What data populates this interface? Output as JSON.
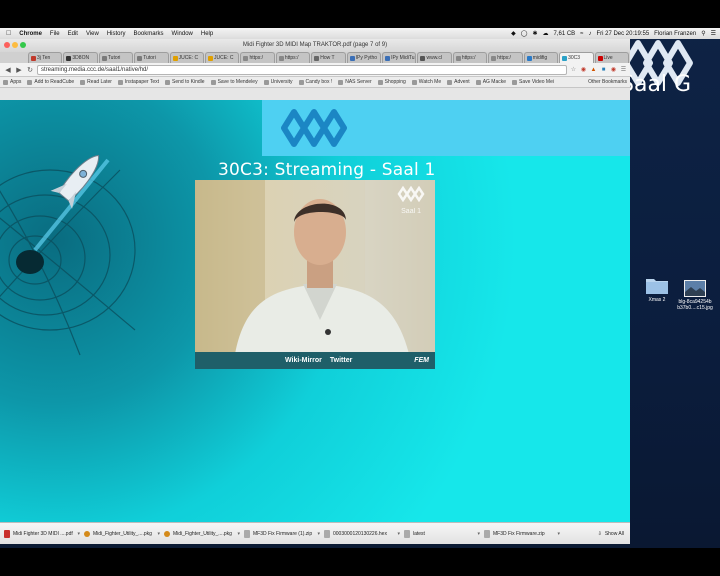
{
  "menubar": {
    "app": "Chrome",
    "items": [
      "File",
      "Edit",
      "View",
      "History",
      "Bookmarks",
      "Window",
      "Help"
    ],
    "battery": "7,61 CB",
    "clock": "Fri 27 Dec 20:19:55",
    "user": "Florian Franzen"
  },
  "window": {
    "title": "Midi Fighter 3D MIDI Map TRAKTOR.pdf (page 7 of 9)",
    "tabs": [
      {
        "label": "3j Ten",
        "color": "#c0392b"
      },
      {
        "label": "3D8ON",
        "color": "#333333"
      },
      {
        "label": "Tutori",
        "color": "#7a7a7a"
      },
      {
        "label": "Tutori",
        "color": "#7a7a7a"
      },
      {
        "label": "JUCE: C",
        "color": "#e0a000"
      },
      {
        "label": "JUCE: C",
        "color": "#e0a000"
      },
      {
        "label": "https:/",
        "color": "#888888"
      },
      {
        "label": "https:/",
        "color": "#888888"
      },
      {
        "label": "How T",
        "color": "#666666"
      },
      {
        "label": "IPy Pytho",
        "color": "#3b6fb6"
      },
      {
        "label": "IPy MidiTu",
        "color": "#3b6fb6"
      },
      {
        "label": "www.cl",
        "color": "#555555"
      },
      {
        "label": "https:/",
        "color": "#888888"
      },
      {
        "label": "https:/",
        "color": "#888888"
      },
      {
        "label": "midifig",
        "color": "#2a7ac7"
      },
      {
        "label": "30C3",
        "color": "#2aa1c7",
        "active": true
      },
      {
        "label": "Live",
        "color": "#cc0000"
      }
    ],
    "url": "streaming.media.ccc.de/saal1/native/hd/",
    "bookmarks": [
      "Apps",
      "Add to ReadCube",
      "Read Later",
      "Instapaper Text",
      "Send to Kindle",
      "Save to Mendeley",
      "University",
      "Candy box !",
      "NAS Server",
      "Shopping",
      "Watch Me",
      "Advent",
      "AG Macke",
      "Save Video Mei"
    ],
    "other_bookmarks": "Other Bookmarks"
  },
  "page": {
    "stream_title": "30C3: Streaming - Saal 1",
    "player_logo_text": "Saal 1",
    "player_links": [
      "Wiki-Mirror",
      "Twitter"
    ],
    "player_brand": "FEM"
  },
  "downloads": {
    "items": [
      {
        "name": "Midi Fighter 3D MIDI ....pdf",
        "type": "pdf"
      },
      {
        "name": "Midi_Fighter_Utility_....pkg",
        "type": "pkg"
      },
      {
        "name": "Midi_Fighter_Utility_....pkg",
        "type": "pkg"
      },
      {
        "name": "MF3D Fix Firmware (1).zip",
        "type": "zip"
      },
      {
        "name": "0003000120130226.hex",
        "type": "file"
      },
      {
        "name": "latest",
        "type": "file"
      },
      {
        "name": "MF3D Fix Firmware.zip",
        "type": "zip"
      }
    ],
    "show_all": "Show All"
  },
  "desktop": {
    "overlay_label": "Saal G",
    "items": [
      {
        "label": "Xmas 2",
        "kind": "folder"
      },
      {
        "label": "blg-8ca94254b b37b0....c15.jpg",
        "kind": "image"
      }
    ]
  }
}
